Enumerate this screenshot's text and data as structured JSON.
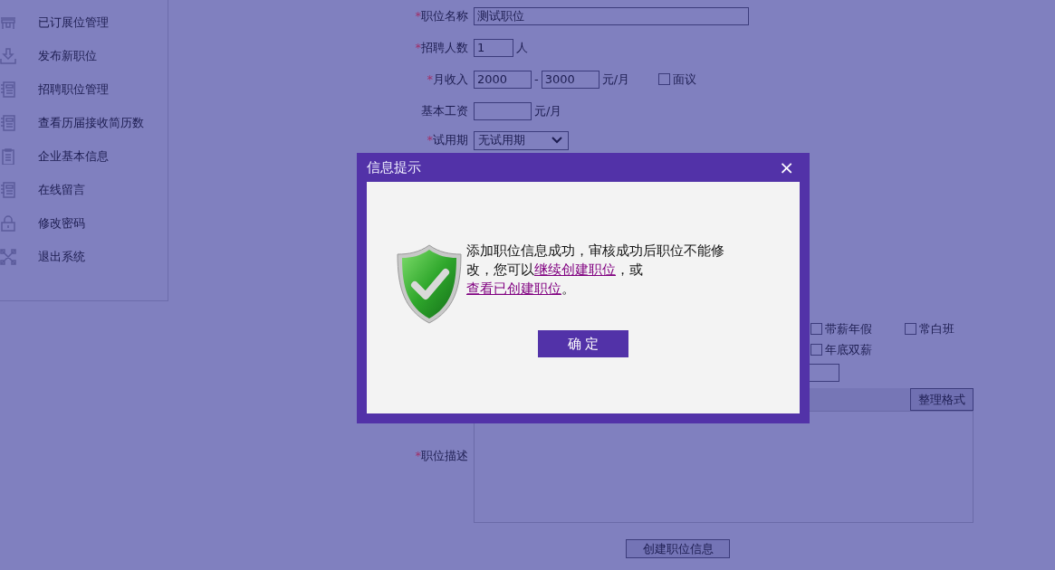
{
  "sidebar": {
    "items": [
      {
        "label": "已订展位管理",
        "kind": "booth"
      },
      {
        "label": "发布新职位",
        "kind": "download"
      },
      {
        "label": "招聘职位管理",
        "kind": "document"
      },
      {
        "label": "查看历届接收简历数",
        "kind": "document"
      },
      {
        "label": "企业基本信息",
        "kind": "clipboard"
      },
      {
        "label": "在线留言",
        "kind": "document"
      },
      {
        "label": "修改密码",
        "kind": "lock"
      },
      {
        "label": "退出系统",
        "kind": "cross"
      }
    ]
  },
  "form": {
    "fields": [
      {
        "kind": "text",
        "label": "职位名称",
        "required_mark": "*",
        "value": "测试职位"
      },
      {
        "kind": "count",
        "label": "招聘人数",
        "required_mark": "*",
        "value": "1",
        "unit": "人"
      },
      {
        "kind": "range",
        "label": "月收入",
        "required_mark": "*",
        "min": "2000",
        "separator": "-",
        "max": "3000",
        "unit": "元/月",
        "option": {
          "label": "面议",
          "checked": false
        }
      },
      {
        "kind": "amount",
        "label": "基本工资",
        "unit": "元/月"
      },
      {
        "kind": "select",
        "label": "试用期",
        "required_mark": "*",
        "value": "无试用期"
      }
    ],
    "benefits": [
      {
        "label": "带薪年假",
        "checked": false
      },
      {
        "label": "常白班",
        "checked": false
      },
      {
        "label": "年底双薪",
        "checked": false
      }
    ],
    "description": {
      "label": "职位描述",
      "required_mark": "*",
      "format_button": "整理格式"
    },
    "submit": "创建职位信息"
  },
  "dialog": {
    "title": "信息提示",
    "close": "×",
    "message": [
      {
        "kind": "text",
        "text": "添加职位信息成功，审核成功后职位不能修改，您可以"
      },
      {
        "kind": "link",
        "text": "继续创建职位"
      },
      {
        "kind": "text",
        "text": "，或"
      },
      {
        "kind": "link",
        "text": "查看已创建职位"
      },
      {
        "kind": "text",
        "text": "。"
      }
    ],
    "ok": "确 定"
  }
}
